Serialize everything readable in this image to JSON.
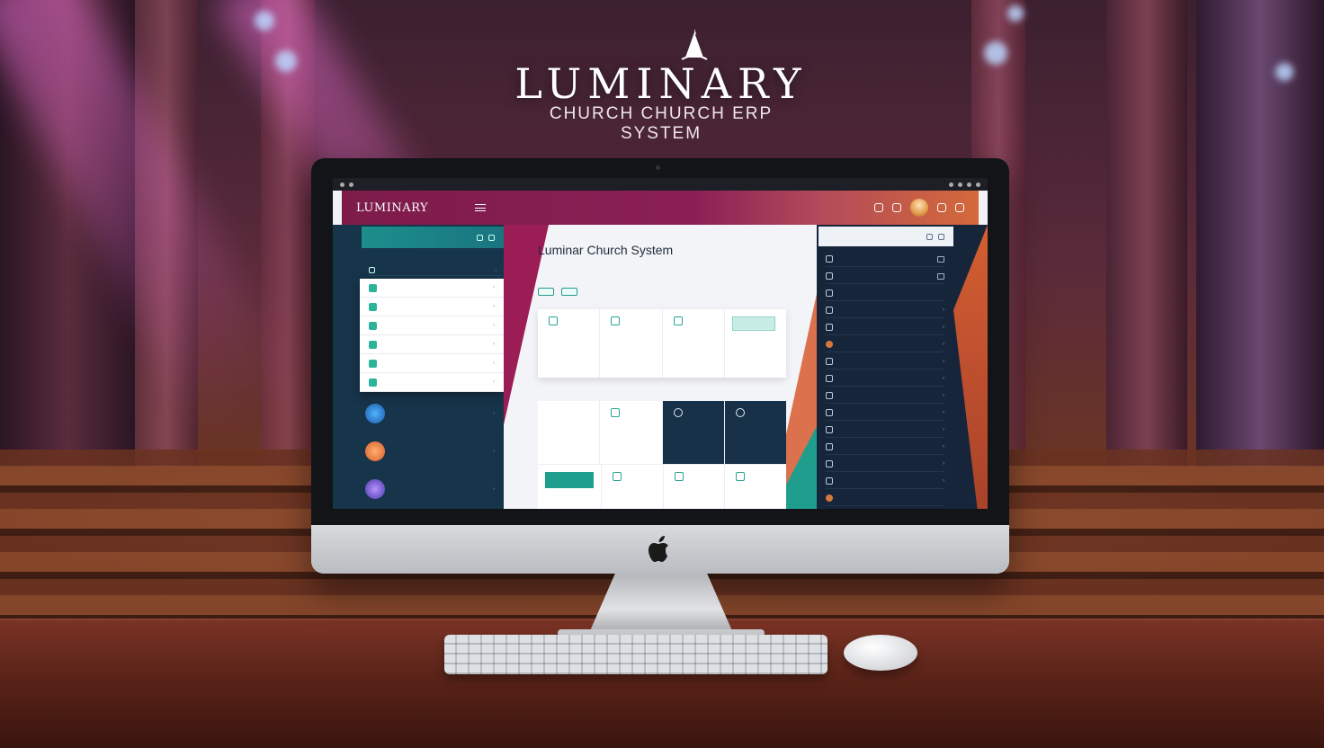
{
  "brand": {
    "title": "LUMINARY",
    "subtitle_line1": "CHURCH CHURCH ERP",
    "subtitle_line2": "SYSTEM"
  },
  "colors": {
    "primary_magenta": "#8a1f56",
    "accent_orange": "#d8633a",
    "accent_teal": "#1e9e8c",
    "navy": "#16344a"
  },
  "screen": {
    "os_bar": {
      "title": ""
    },
    "topbar": {
      "logo": "LUMINARY",
      "logo_sub": "",
      "nav": [
        "",
        "",
        ""
      ],
      "nav_right": [
        "",
        "",
        "",
        "",
        ""
      ]
    },
    "left": {
      "head_label": "",
      "caption": "",
      "sub_label": "",
      "menu": [
        {
          "label": "",
          "icon": "leaf-icon"
        },
        {
          "label": "",
          "icon": "people-icon"
        },
        {
          "label": "",
          "icon": "calendar-icon"
        },
        {
          "label": "",
          "icon": "book-icon"
        },
        {
          "label": "",
          "icon": "donate-icon"
        },
        {
          "label": "",
          "icon": "settings-icon"
        }
      ],
      "rows": [
        {
          "label": "",
          "sub": ""
        },
        {
          "label": "",
          "sub": ""
        },
        {
          "label": "",
          "sub": ""
        }
      ]
    },
    "center": {
      "title": "Luminar Church System",
      "desc": "",
      "buttons": [
        "",
        ""
      ],
      "row1": [
        {
          "title": "",
          "sub": ""
        },
        {
          "title": "",
          "sub": ""
        },
        {
          "title": "",
          "sub": ""
        },
        {
          "title": "",
          "sub": "",
          "tag": ""
        }
      ],
      "section_label": "",
      "row2": [
        {
          "title": "",
          "sub": ""
        },
        {
          "title": "",
          "sub": ""
        },
        {
          "title": "",
          "sub": ""
        },
        {
          "title": "",
          "sub": ""
        }
      ],
      "row3": [
        {
          "title": "",
          "button": ""
        },
        {
          "title": ""
        },
        {
          "title": ""
        },
        {
          "title": ""
        }
      ]
    },
    "right": {
      "head_label": "",
      "rows": [
        "",
        "",
        "",
        "",
        "",
        "",
        "",
        "",
        "",
        "",
        "",
        "",
        "",
        "",
        ""
      ]
    }
  }
}
